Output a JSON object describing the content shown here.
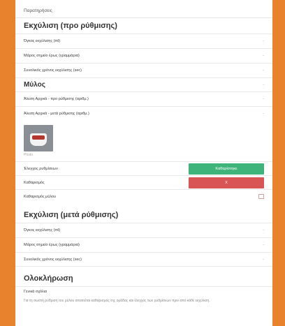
{
  "header": {
    "note": "Παρατηρήσεις"
  },
  "pre_extraction": {
    "title": "Εκχύλιση (προ ρύθμισης)",
    "rows": [
      {
        "label": "Όγκος εκχύλισης (ml)",
        "value": "-"
      },
      {
        "label": "Μάρος σημείο έρως (γραμμάρια)",
        "value": "-"
      },
      {
        "label": "Συνολικός χρόνος εκχύλισης (sec)",
        "value": "-"
      }
    ]
  },
  "milk": {
    "title": "Μύλος",
    "value": "-",
    "rows": [
      {
        "label": "Άλεση Αρχικά - προ ρύθμισης (αριθμ.)",
        "value": "-"
      },
      {
        "label": "Άλεση Αρχικά - μετά ρύθμισης (αριθμ.)",
        "value": "-"
      }
    ],
    "photo_caption": "Photo"
  },
  "actions": {
    "control_label": "Έλεγχος ρυθμίσεων",
    "control_button": "Καθαρίστηκε",
    "clean_label": "Καθαρισμός",
    "clean_button": "Χ",
    "milk_label": "Καθαρισμός μύλου"
  },
  "post_extraction": {
    "title": "Εκχύλιση (μετά ρύθμισης)",
    "rows": [
      {
        "label": "Όγκος εκχύλισης (ml)",
        "value": "-"
      },
      {
        "label": "Μάρος σημείο έρως (γραμμάρια)",
        "value": "-"
      },
      {
        "label": "Συνολικός χρόνος εκχύλισης (sec)",
        "value": "-"
      }
    ]
  },
  "completion": {
    "title": "Ολοκλήρωση",
    "label": "Γενικά σχόλια",
    "text": "Για τη σωστή ρύθμιση του μύλου απαιτείται καθαρισμός της ομάδας και έλεγχος των ρυθμίσεων πριν από κάθε εκχύλιση."
  },
  "colors": {
    "background": "#e8822d",
    "green": "#3eb37a",
    "red": "#d85455"
  }
}
